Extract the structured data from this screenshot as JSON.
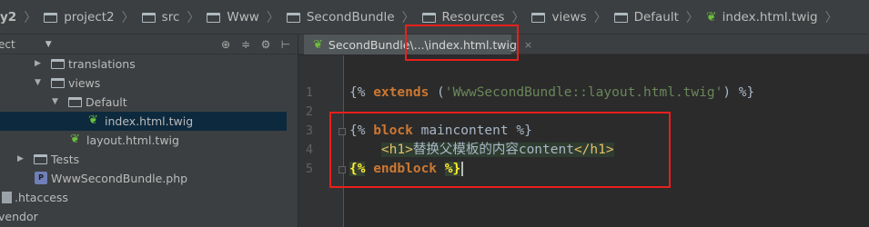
{
  "breadcrumb": [
    {
      "label": "y2",
      "icon": "folder-icon",
      "first": true
    },
    {
      "label": "project2",
      "icon": "folder-icon"
    },
    {
      "label": "src",
      "icon": "folder-icon"
    },
    {
      "label": "Www",
      "icon": "folder-icon"
    },
    {
      "label": "SecondBundle",
      "icon": "folder-icon"
    },
    {
      "label": "Resources",
      "icon": "folder-icon"
    },
    {
      "label": "views",
      "icon": "folder-icon"
    },
    {
      "label": "Default",
      "icon": "folder-icon"
    },
    {
      "label": "index.html.twig",
      "icon": "twig-file-icon"
    }
  ],
  "project_panel": {
    "view_label": "ect",
    "tools": [
      "target-icon",
      "collapse-icon",
      "gear-icon",
      "hide-icon"
    ]
  },
  "tree": [
    {
      "label": "translations",
      "type": "folder",
      "expanded": false
    },
    {
      "label": "views",
      "type": "folder",
      "expanded": true
    },
    {
      "label": "Default",
      "type": "folder",
      "expanded": true
    },
    {
      "label": "index.html.twig",
      "type": "twig",
      "selected": true
    },
    {
      "label": "layout.html.twig",
      "type": "twig"
    },
    {
      "label": "Tests",
      "type": "folder",
      "expanded": false
    },
    {
      "label": "WwwSecondBundle.php",
      "type": "php"
    },
    {
      "label": ".htaccess",
      "type": "file"
    },
    {
      "label": "vendor",
      "type": "folder"
    }
  ],
  "editor_tab": {
    "label_prefix": "SecondBundle\\",
    "label_suffix": "...\\index.html.twig",
    "close": "×"
  },
  "editor": {
    "line_numbers": [
      "1",
      "2",
      "3",
      "4",
      "5"
    ],
    "line1": {
      "open": "{%",
      "kw": "extends",
      "paren_open": "(",
      "str": "'WwwSecondBundle::layout.html.twig'",
      "paren_close": ")",
      "close": "%}"
    },
    "line3": {
      "open": "{%",
      "kw": "block",
      "name": "maincontent",
      "close": "%}"
    },
    "line4": {
      "tag_open": "<h1>",
      "text": "替换父模板的内容content",
      "tag_close": "</h1>"
    },
    "line5": {
      "open": "{%",
      "kw": "endblock",
      "close": "%}"
    }
  },
  "colors": {
    "annotation": "#e8201c",
    "keyword": "#cc7832",
    "string": "#6a8759",
    "twig_icon": "#6cbf3c"
  }
}
